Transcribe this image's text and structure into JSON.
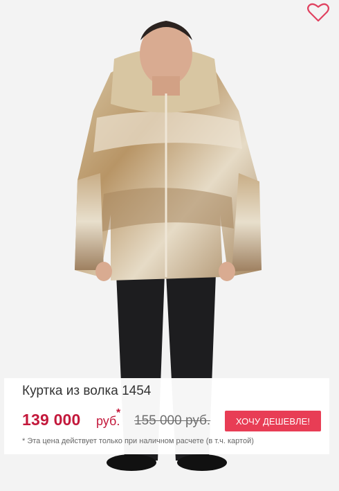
{
  "product": {
    "title": "Куртка из волка 1454",
    "price": "139 000",
    "currency": "руб.",
    "asterisk": "*",
    "old_price": "155 000 руб.",
    "cta_label": "ХОЧУ ДЕШЕВЛЕ!",
    "footnote": "* Эта цена действует только при наличном расчете (в т.ч. картой)"
  },
  "icons": {
    "favorite": "heart-icon"
  },
  "colors": {
    "accent": "#c3183b",
    "button": "#e83d55",
    "background": "#f3f3f3"
  }
}
